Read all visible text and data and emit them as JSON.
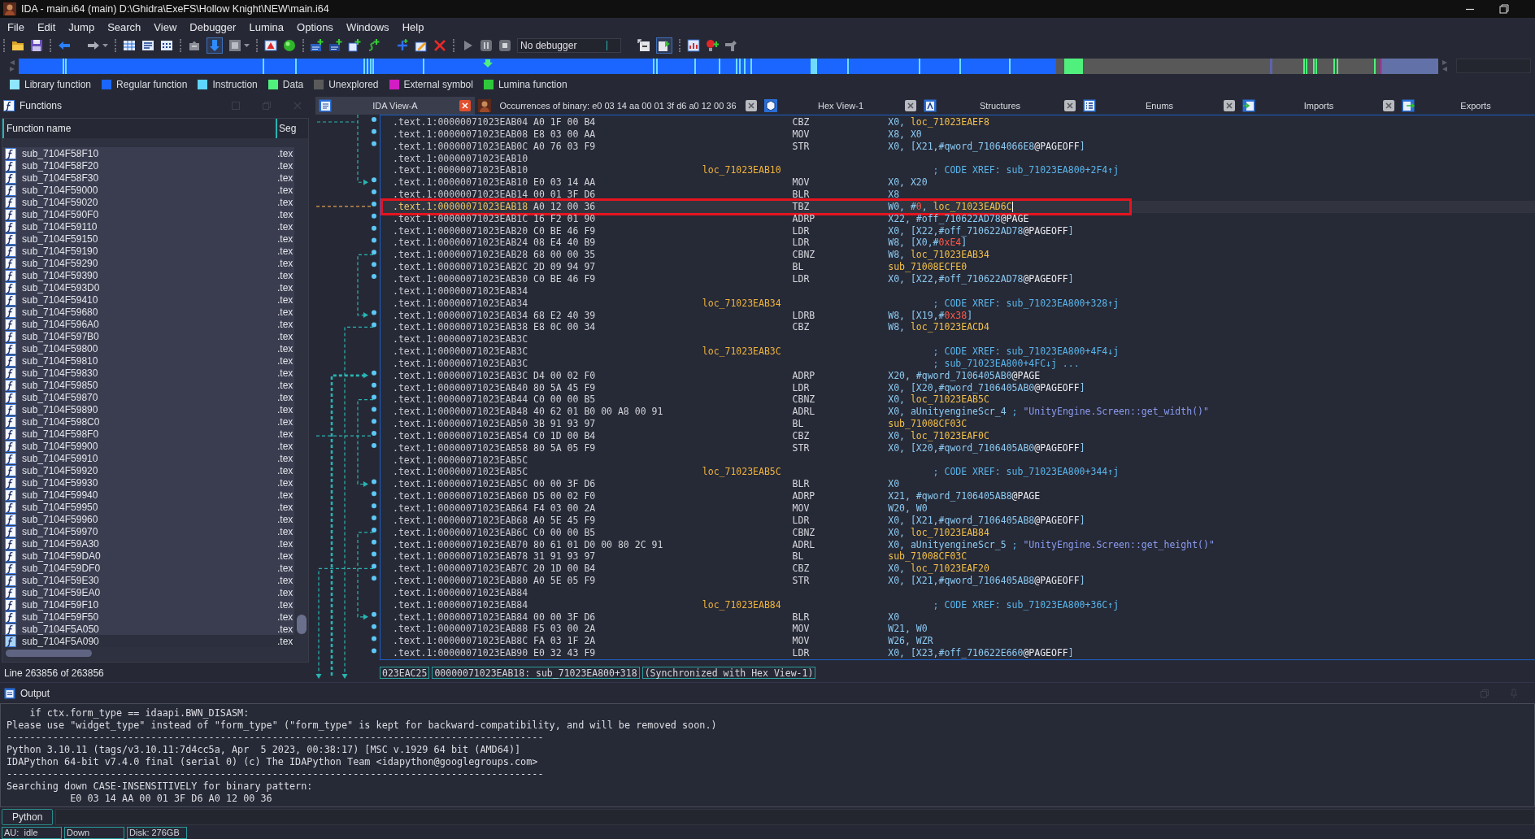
{
  "window": {
    "title": "IDA - main.i64 (main) D:\\Ghidra\\ExeFS\\Hollow Knight\\NEW\\main.i64"
  },
  "menu": [
    "File",
    "Edit",
    "Jump",
    "Search",
    "View",
    "Debugger",
    "Lumina",
    "Options",
    "Windows",
    "Help"
  ],
  "toolbar": {
    "debugger_select": {
      "value": "No debugger"
    }
  },
  "legend": [
    {
      "label": "Library function",
      "color": "#8ee6ff"
    },
    {
      "label": "Regular function",
      "color": "#1a66ff"
    },
    {
      "label": "Instruction",
      "color": "#5fd4ff"
    },
    {
      "label": "Data",
      "color": "#50f07c"
    },
    {
      "label": "Unexplored",
      "color": "#5a5a5a"
    },
    {
      "label": "External symbol",
      "color": "#d21cc4"
    },
    {
      "label": "Lumina function",
      "color": "#2fc83c"
    }
  ],
  "functions_panel": {
    "title": "Functions",
    "columns": [
      "Function name",
      "Seg"
    ],
    "rows": [
      {
        "name": "sub_7104F58F10",
        "segment": ".tex",
        "selected": false
      },
      {
        "name": "sub_7104F58F20",
        "segment": ".tex",
        "selected": false
      },
      {
        "name": "sub_7104F58F30",
        "segment": ".tex",
        "selected": false
      },
      {
        "name": "sub_7104F59000",
        "segment": ".tex",
        "selected": false
      },
      {
        "name": "sub_7104F59020",
        "segment": ".tex",
        "selected": false
      },
      {
        "name": "sub_7104F590F0",
        "segment": ".tex",
        "selected": false
      },
      {
        "name": "sub_7104F59110",
        "segment": ".tex",
        "selected": false
      },
      {
        "name": "sub_7104F59150",
        "segment": ".tex",
        "selected": false
      },
      {
        "name": "sub_7104F59190",
        "segment": ".tex",
        "selected": false
      },
      {
        "name": "sub_7104F59290",
        "segment": ".tex",
        "selected": false
      },
      {
        "name": "sub_7104F59390",
        "segment": ".tex",
        "selected": false
      },
      {
        "name": "sub_7104F593D0",
        "segment": ".tex",
        "selected": false
      },
      {
        "name": "sub_7104F59410",
        "segment": ".tex",
        "selected": false
      },
      {
        "name": "sub_7104F59680",
        "segment": ".tex",
        "selected": false
      },
      {
        "name": "sub_7104F596A0",
        "segment": ".tex",
        "selected": false
      },
      {
        "name": "sub_7104F597B0",
        "segment": ".tex",
        "selected": false
      },
      {
        "name": "sub_7104F59800",
        "segment": ".tex",
        "selected": false
      },
      {
        "name": "sub_7104F59810",
        "segment": ".tex",
        "selected": false
      },
      {
        "name": "sub_7104F59830",
        "segment": ".tex",
        "selected": false
      },
      {
        "name": "sub_7104F59850",
        "segment": ".tex",
        "selected": false
      },
      {
        "name": "sub_7104F59870",
        "segment": ".tex",
        "selected": false
      },
      {
        "name": "sub_7104F59890",
        "segment": ".tex",
        "selected": false
      },
      {
        "name": "sub_7104F598C0",
        "segment": ".tex",
        "selected": false
      },
      {
        "name": "sub_7104F598F0",
        "segment": ".tex",
        "selected": false
      },
      {
        "name": "sub_7104F59900",
        "segment": ".tex",
        "selected": false
      },
      {
        "name": "sub_7104F59910",
        "segment": ".tex",
        "selected": false
      },
      {
        "name": "sub_7104F59920",
        "segment": ".tex",
        "selected": false
      },
      {
        "name": "sub_7104F59930",
        "segment": ".tex",
        "selected": false
      },
      {
        "name": "sub_7104F59940",
        "segment": ".tex",
        "selected": false
      },
      {
        "name": "sub_7104F59950",
        "segment": ".tex",
        "selected": false
      },
      {
        "name": "sub_7104F59960",
        "segment": ".tex",
        "selected": false
      },
      {
        "name": "sub_7104F59970",
        "segment": ".tex",
        "selected": false
      },
      {
        "name": "sub_7104F59A30",
        "segment": ".tex",
        "selected": false
      },
      {
        "name": "sub_7104F59DA0",
        "segment": ".tex",
        "selected": false
      },
      {
        "name": "sub_7104F59DF0",
        "segment": ".tex",
        "selected": false
      },
      {
        "name": "sub_7104F59E30",
        "segment": ".tex",
        "selected": false
      },
      {
        "name": "sub_7104F59EA0",
        "segment": ".tex",
        "selected": false
      },
      {
        "name": "sub_7104F59F10",
        "segment": ".tex",
        "selected": false
      },
      {
        "name": "sub_7104F59F50",
        "segment": ".tex",
        "selected": false
      },
      {
        "name": "sub_7104F5A050",
        "segment": ".tex",
        "selected": false
      },
      {
        "name": "sub_7104F5A090",
        "segment": ".tex",
        "selected": true
      }
    ],
    "status": "Line 263856 of 263856"
  },
  "tabs": [
    {
      "label": "IDA View-A",
      "kind": "disassembly",
      "selected": true
    },
    {
      "label": "Occurrences of binary: e0 03 14 aa 00 01 3f d6 a0 12 00 36",
      "kind": "search",
      "selected": false
    },
    {
      "label": "Hex View-1",
      "kind": "hex",
      "selected": false
    },
    {
      "label": "Structures",
      "kind": "structures",
      "selected": false
    },
    {
      "label": "Enums",
      "kind": "enums",
      "selected": false
    },
    {
      "label": "Imports",
      "kind": "imports",
      "selected": false
    },
    {
      "label": "Exports",
      "kind": "exports",
      "selected": false
    }
  ],
  "disasm": {
    "rows": [
      {
        "address": ".text.1:00000071023EAB04",
        "bytes": "A0 1F 00 B4",
        "mnemonic": "CBZ",
        "operands": [
          {
            "kind": "reg",
            "text": "X0, "
          },
          {
            "kind": "name",
            "text": "loc_71023EAEF8"
          }
        ],
        "selected": false,
        "marked": false
      },
      {
        "address": ".text.1:00000071023EAB08",
        "bytes": "E8 03 00 AA",
        "mnemonic": "MOV",
        "operands": [
          {
            "kind": "reg",
            "text": "X8, X0"
          }
        ],
        "selected": false,
        "marked": false
      },
      {
        "address": ".text.1:00000071023EAB0C",
        "bytes": "A0 76 03 F9",
        "mnemonic": "STR",
        "operands": [
          {
            "kind": "reg",
            "text": "X0, [X21,#qword_71064066E8"
          },
          {
            "kind": "plain",
            "text": "@PAGEOFF"
          },
          {
            "kind": "reg",
            "text": "]"
          }
        ],
        "selected": false,
        "marked": false
      },
      {
        "address": ".text.1:00000071023EAB10",
        "selected": false,
        "marked": false
      },
      {
        "address": ".text.1:00000071023EAB10",
        "label": "loc_71023EAB10",
        "comment": "; CODE XREF: sub_71023EA800+2F4↑j",
        "selected": false,
        "marked": false
      },
      {
        "address": ".text.1:00000071023EAB10",
        "bytes": "E0 03 14 AA",
        "mnemonic": "MOV",
        "operands": [
          {
            "kind": "reg",
            "text": "X0, X20"
          }
        ],
        "selected": false,
        "marked": false
      },
      {
        "address": ".text.1:00000071023EAB14",
        "bytes": "00 01 3F D6",
        "mnemonic": "BLR",
        "operands": [
          {
            "kind": "reg",
            "text": "X8"
          }
        ],
        "selected": false,
        "marked": false
      },
      {
        "address": ".text.1:00000071023EAB18",
        "bytes": "A0 12 00 36",
        "mnemonic": "TBZ",
        "operands": [
          {
            "kind": "reg",
            "text": "W0, #"
          },
          {
            "kind": "num",
            "text": "0"
          },
          {
            "kind": "reg",
            "text": ", "
          },
          {
            "kind": "name",
            "text": "loc_71023EAD6C"
          }
        ],
        "selected": true,
        "marked": true
      },
      {
        "address": ".text.1:00000071023EAB1C",
        "bytes": "16 F2 01 90",
        "mnemonic": "ADRP",
        "operands": [
          {
            "kind": "reg",
            "text": "X22, #off_710622AD78"
          },
          {
            "kind": "plain",
            "text": "@PAGE"
          }
        ],
        "selected": false,
        "marked": false
      },
      {
        "address": ".text.1:00000071023EAB20",
        "bytes": "C0 BE 46 F9",
        "mnemonic": "LDR",
        "operands": [
          {
            "kind": "reg",
            "text": "X0, [X22,#off_710622AD78"
          },
          {
            "kind": "plain",
            "text": "@PAGEOFF"
          },
          {
            "kind": "reg",
            "text": "]"
          }
        ],
        "selected": false,
        "marked": false
      },
      {
        "address": ".text.1:00000071023EAB24",
        "bytes": "08 E4 40 B9",
        "mnemonic": "LDR",
        "operands": [
          {
            "kind": "reg",
            "text": "W8, [X0,#"
          },
          {
            "kind": "num",
            "text": "0xE4"
          },
          {
            "kind": "reg",
            "text": "]"
          }
        ],
        "selected": false,
        "marked": false
      },
      {
        "address": ".text.1:00000071023EAB28",
        "bytes": "68 00 00 35",
        "mnemonic": "CBNZ",
        "operands": [
          {
            "kind": "reg",
            "text": "W8, "
          },
          {
            "kind": "name",
            "text": "loc_71023EAB34"
          }
        ],
        "selected": false,
        "marked": false
      },
      {
        "address": ".text.1:00000071023EAB2C",
        "bytes": "2D 09 94 97",
        "mnemonic": "BL",
        "operands": [
          {
            "kind": "name",
            "text": "sub_71008ECFE0"
          }
        ],
        "selected": false,
        "marked": false
      },
      {
        "address": ".text.1:00000071023EAB30",
        "bytes": "C0 BE 46 F9",
        "mnemonic": "LDR",
        "operands": [
          {
            "kind": "reg",
            "text": "X0, [X22,#off_710622AD78"
          },
          {
            "kind": "plain",
            "text": "@PAGEOFF"
          },
          {
            "kind": "reg",
            "text": "]"
          }
        ],
        "selected": false,
        "marked": false
      },
      {
        "address": ".text.1:00000071023EAB34",
        "selected": false,
        "marked": false
      },
      {
        "address": ".text.1:00000071023EAB34",
        "label": "loc_71023EAB34",
        "comment": "; CODE XREF: sub_71023EA800+328↑j",
        "selected": false,
        "marked": false
      },
      {
        "address": ".text.1:00000071023EAB34",
        "bytes": "68 E2 40 39",
        "mnemonic": "LDRB",
        "operands": [
          {
            "kind": "reg",
            "text": "W8, [X19,#"
          },
          {
            "kind": "num",
            "text": "0x38"
          },
          {
            "kind": "reg",
            "text": "]"
          }
        ],
        "selected": false,
        "marked": false
      },
      {
        "address": ".text.1:00000071023EAB38",
        "bytes": "E8 0C 00 34",
        "mnemonic": "CBZ",
        "operands": [
          {
            "kind": "reg",
            "text": "W8, "
          },
          {
            "kind": "name",
            "text": "loc_71023EACD4"
          }
        ],
        "selected": false,
        "marked": false
      },
      {
        "address": ".text.1:00000071023EAB3C",
        "selected": false,
        "marked": false
      },
      {
        "address": ".text.1:00000071023EAB3C",
        "label": "loc_71023EAB3C",
        "comment": "; CODE XREF: sub_71023EA800+4F4↓j",
        "selected": false,
        "marked": false
      },
      {
        "address": ".text.1:00000071023EAB3C",
        "comment": "; sub_71023EA800+4FC↓j ...",
        "selected": false,
        "marked": false
      },
      {
        "address": ".text.1:00000071023EAB3C",
        "bytes": "D4 00 02 F0",
        "mnemonic": "ADRP",
        "operands": [
          {
            "kind": "reg",
            "text": "X20, #qword_7106405AB0"
          },
          {
            "kind": "plain",
            "text": "@PAGE"
          }
        ],
        "selected": false,
        "marked": false
      },
      {
        "address": ".text.1:00000071023EAB40",
        "bytes": "80 5A 45 F9",
        "mnemonic": "LDR",
        "operands": [
          {
            "kind": "reg",
            "text": "X0, [X20,#qword_7106405AB0"
          },
          {
            "kind": "plain",
            "text": "@PAGEOFF"
          },
          {
            "kind": "reg",
            "text": "]"
          }
        ],
        "selected": false,
        "marked": false
      },
      {
        "address": ".text.1:00000071023EAB44",
        "bytes": "C0 00 00 B5",
        "mnemonic": "CBNZ",
        "operands": [
          {
            "kind": "reg",
            "text": "X0, "
          },
          {
            "kind": "name",
            "text": "loc_71023EAB5C"
          }
        ],
        "selected": false,
        "marked": false
      },
      {
        "address": ".text.1:00000071023EAB48",
        "bytes": "40 62 01 B0 00 A8 00 91",
        "mnemonic": "ADRL",
        "operands": [
          {
            "kind": "reg",
            "text": "X0, aUnityengineScr_4 "
          },
          {
            "kind": "comment",
            "text": "; "
          },
          {
            "kind": "string",
            "text": "\"UnityEngine.Screen::get_width()\""
          }
        ],
        "selected": false,
        "marked": false
      },
      {
        "address": ".text.1:00000071023EAB50",
        "bytes": "3B 91 93 97",
        "mnemonic": "BL",
        "operands": [
          {
            "kind": "name",
            "text": "sub_71008CF03C"
          }
        ],
        "selected": false,
        "marked": false
      },
      {
        "address": ".text.1:00000071023EAB54",
        "bytes": "C0 1D 00 B4",
        "mnemonic": "CBZ",
        "operands": [
          {
            "kind": "reg",
            "text": "X0, "
          },
          {
            "kind": "name",
            "text": "loc_71023EAF0C"
          }
        ],
        "selected": false,
        "marked": false
      },
      {
        "address": ".text.1:00000071023EAB58",
        "bytes": "80 5A 05 F9",
        "mnemonic": "STR",
        "operands": [
          {
            "kind": "reg",
            "text": "X0, [X20,#qword_7106405AB0"
          },
          {
            "kind": "plain",
            "text": "@PAGEOFF"
          },
          {
            "kind": "reg",
            "text": "]"
          }
        ],
        "selected": false,
        "marked": false
      },
      {
        "address": ".text.1:00000071023EAB5C",
        "selected": false,
        "marked": false
      },
      {
        "address": ".text.1:00000071023EAB5C",
        "label": "loc_71023EAB5C",
        "comment": "; CODE XREF: sub_71023EA800+344↑j",
        "selected": false,
        "marked": false
      },
      {
        "address": ".text.1:00000071023EAB5C",
        "bytes": "00 00 3F D6",
        "mnemonic": "BLR",
        "operands": [
          {
            "kind": "reg",
            "text": "X0"
          }
        ],
        "selected": false,
        "marked": false
      },
      {
        "address": ".text.1:00000071023EAB60",
        "bytes": "D5 00 02 F0",
        "mnemonic": "ADRP",
        "operands": [
          {
            "kind": "reg",
            "text": "X21, #qword_7106405AB8"
          },
          {
            "kind": "plain",
            "text": "@PAGE"
          }
        ],
        "selected": false,
        "marked": false
      },
      {
        "address": ".text.1:00000071023EAB64",
        "bytes": "F4 03 00 2A",
        "mnemonic": "MOV",
        "operands": [
          {
            "kind": "reg",
            "text": "W20, W0"
          }
        ],
        "selected": false,
        "marked": false
      },
      {
        "address": ".text.1:00000071023EAB68",
        "bytes": "A0 5E 45 F9",
        "mnemonic": "LDR",
        "operands": [
          {
            "kind": "reg",
            "text": "X0, [X21,#qword_7106405AB8"
          },
          {
            "kind": "plain",
            "text": "@PAGEOFF"
          },
          {
            "kind": "reg",
            "text": "]"
          }
        ],
        "selected": false,
        "marked": false
      },
      {
        "address": ".text.1:00000071023EAB6C",
        "bytes": "C0 00 00 B5",
        "mnemonic": "CBNZ",
        "operands": [
          {
            "kind": "reg",
            "text": "X0, "
          },
          {
            "kind": "name",
            "text": "loc_71023EAB84"
          }
        ],
        "selected": false,
        "marked": false
      },
      {
        "address": ".text.1:00000071023EAB70",
        "bytes": "80 61 01 D0 00 80 2C 91",
        "mnemonic": "ADRL",
        "operands": [
          {
            "kind": "reg",
            "text": "X0, aUnityengineScr_5 "
          },
          {
            "kind": "comment",
            "text": "; "
          },
          {
            "kind": "string",
            "text": "\"UnityEngine.Screen::get_height()\""
          }
        ],
        "selected": false,
        "marked": false
      },
      {
        "address": ".text.1:00000071023EAB78",
        "bytes": "31 91 93 97",
        "mnemonic": "BL",
        "operands": [
          {
            "kind": "name",
            "text": "sub_71008CF03C"
          }
        ],
        "selected": false,
        "marked": false
      },
      {
        "address": ".text.1:00000071023EAB7C",
        "bytes": "20 1D 00 B4",
        "mnemonic": "CBZ",
        "operands": [
          {
            "kind": "reg",
            "text": "X0, "
          },
          {
            "kind": "name",
            "text": "loc_71023EAF20"
          }
        ],
        "selected": false,
        "marked": false
      },
      {
        "address": ".text.1:00000071023EAB80",
        "bytes": "A0 5E 05 F9",
        "mnemonic": "STR",
        "operands": [
          {
            "kind": "reg",
            "text": "X0, [X21,#qword_7106405AB8"
          },
          {
            "kind": "plain",
            "text": "@PAGEOFF"
          },
          {
            "kind": "reg",
            "text": "]"
          }
        ],
        "selected": false,
        "marked": false
      },
      {
        "address": ".text.1:00000071023EAB84",
        "selected": false,
        "marked": false
      },
      {
        "address": ".text.1:00000071023EAB84",
        "label": "loc_71023EAB84",
        "comment": "; CODE XREF: sub_71023EA800+36C↑j",
        "selected": false,
        "marked": false
      },
      {
        "address": ".text.1:00000071023EAB84",
        "bytes": "00 00 3F D6",
        "mnemonic": "BLR",
        "operands": [
          {
            "kind": "reg",
            "text": "X0"
          }
        ],
        "selected": false,
        "marked": false
      },
      {
        "address": ".text.1:00000071023EAB88",
        "bytes": "F5 03 00 2A",
        "mnemonic": "MOV",
        "operands": [
          {
            "kind": "reg",
            "text": "W21, W0"
          }
        ],
        "selected": false,
        "marked": false
      },
      {
        "address": ".text.1:00000071023EAB8C",
        "bytes": "FA 03 1F 2A",
        "mnemonic": "MOV",
        "operands": [
          {
            "kind": "reg",
            "text": "W26, WZR"
          }
        ],
        "selected": false,
        "marked": false
      },
      {
        "address": ".text.1:00000071023EAB90",
        "bytes": "E0 32 43 F9",
        "mnemonic": "LDR",
        "operands": [
          {
            "kind": "reg",
            "text": "X0, [X23,#off_710622E660"
          },
          {
            "kind": "plain",
            "text": "@PAGEOFF"
          },
          {
            "kind": "reg",
            "text": "]"
          }
        ],
        "selected": false,
        "marked": false
      }
    ],
    "status": [
      "023EAC25",
      "00000071023EAB18: sub_71023EA800+318",
      "(Synchronized with Hex View-1)"
    ]
  },
  "output": {
    "title": "Output",
    "lines": [
      "    if ctx.form_type == idaapi.BWN_DISASM:",
      "Please use \"widget_type\" instead of \"form_type\" (\"form_type\" is kept for backward-compatibility, and will be removed soon.)",
      "---------------------------------------------------------------------------------------------",
      "Python 3.10.11 (tags/v3.10.11:7d4cc5a, Apr  5 2023, 00:38:17) [MSC v.1929 64 bit (AMD64)]",
      "IDAPython 64-bit v7.4.0 final (serial 0) (c) The IDAPython Team <idapython@googlegroups.com>",
      "---------------------------------------------------------------------------------------------",
      "Searching down CASE-INSENSITIVELY for binary pattern:",
      "           E0 03 14 AA 00 01 3F D6 A0 12 00 36"
    ]
  },
  "cli_button": "Python",
  "status_bar": [
    "AU:  idle",
    "Down",
    "Disk: 276GB"
  ]
}
